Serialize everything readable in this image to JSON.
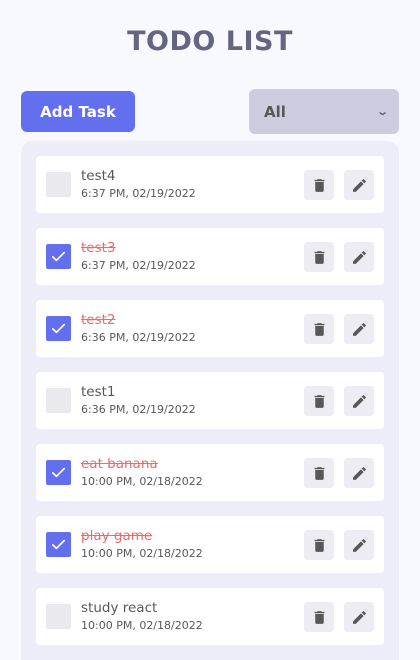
{
  "header": {
    "title": "TODO LIST"
  },
  "toolbar": {
    "add_label": "Add Task",
    "filter_value": "All"
  },
  "colors": {
    "accent": "#646ff0",
    "title": "#646681",
    "completed_text": "#e96b6b",
    "panel": "#ecedf6"
  },
  "todos": [
    {
      "title": "test4",
      "time": "6:37 PM, 02/19/2022",
      "completed": false
    },
    {
      "title": "test3",
      "time": "6:37 PM, 02/19/2022",
      "completed": true
    },
    {
      "title": "test2",
      "time": "6:36 PM, 02/19/2022",
      "completed": true
    },
    {
      "title": "test1",
      "time": "6:36 PM, 02/19/2022",
      "completed": false
    },
    {
      "title": "eat banana",
      "time": "10:00 PM, 02/18/2022",
      "completed": true
    },
    {
      "title": "play game",
      "time": "10:00 PM, 02/18/2022",
      "completed": true
    },
    {
      "title": "study react",
      "time": "10:00 PM, 02/18/2022",
      "completed": false
    }
  ],
  "icons": {
    "checkbox_checked": "check-icon",
    "delete": "trash-icon",
    "edit": "pencil-icon",
    "filter_chevron": "chevron-down-icon"
  }
}
